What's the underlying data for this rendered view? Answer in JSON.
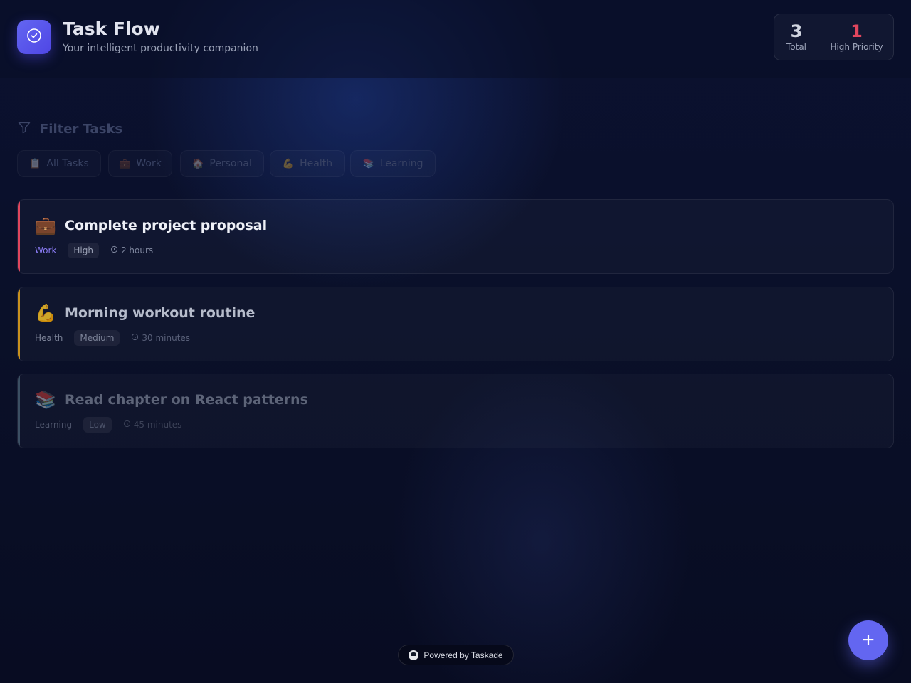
{
  "header": {
    "title": "Task Flow",
    "subtitle": "Your intelligent productivity companion",
    "logo_icon": "check-circle-icon",
    "stats": [
      {
        "value": "3",
        "label": "Total",
        "color": "#d1d5e0"
      },
      {
        "value": "1",
        "label": "High Priority",
        "color": "#e0465e"
      }
    ]
  },
  "filter": {
    "title": "Filter Tasks",
    "icon": "funnel-icon",
    "chips": [
      {
        "icon": "📋",
        "label": "All Tasks"
      },
      {
        "icon": "💼",
        "label": "Work"
      },
      {
        "icon": "🏠",
        "label": "Personal"
      },
      {
        "icon": "💪",
        "label": "Health"
      },
      {
        "icon": "📚",
        "label": "Learning"
      }
    ]
  },
  "tasks": [
    {
      "emoji": "💼",
      "title": "Complete project proposal",
      "category": "Work",
      "priority": "High",
      "time": "2 hours",
      "priority_color": "#e0465e"
    },
    {
      "emoji": "💪",
      "title": "Morning workout routine",
      "category": "Health",
      "priority": "Medium",
      "time": "30 minutes",
      "priority_color": "#c8911e"
    },
    {
      "emoji": "📚",
      "title": "Read chapter on React patterns",
      "category": "Learning",
      "priority": "Low",
      "time": "45 minutes",
      "priority_color": "#3b4f63"
    }
  ],
  "footer": {
    "powered_by": "Powered by Taskade",
    "fab_label": "+"
  },
  "colors": {
    "accent": "#6366f1",
    "background": "#0a1029"
  }
}
